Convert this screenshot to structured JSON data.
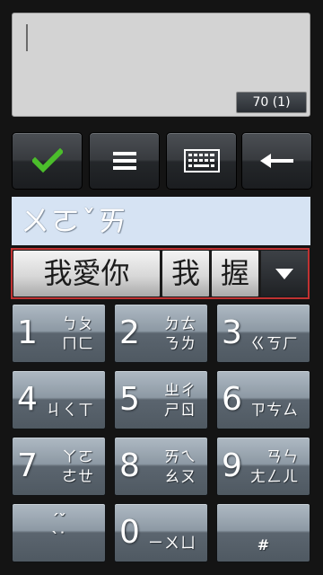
{
  "editor": {
    "char_counter": "70 (1)"
  },
  "toolbar": {
    "icons": [
      "checkmark-icon",
      "menu-icon",
      "keyboard-icon",
      "backspace-icon"
    ],
    "colors": {
      "check": "#4bbd2b"
    }
  },
  "composition": {
    "text": "ㄨㄛˇㄞ"
  },
  "candidates": {
    "items": [
      "我愛你",
      "我",
      "握"
    ],
    "more_icon": "dropdown-arrow-icon"
  },
  "keypad": {
    "keys": [
      {
        "num": "1",
        "l1": "ㄅㄆ",
        "l2": "ㄇㄈ"
      },
      {
        "num": "2",
        "l1": "ㄉㄊ",
        "l2": "ㄋㄌ"
      },
      {
        "num": "3",
        "l1": "",
        "l2": "ㄍㄎㄏ"
      },
      {
        "num": "4",
        "l1": "",
        "l2": "ㄐㄑㄒ"
      },
      {
        "num": "5",
        "l1": "ㄓㄔ",
        "l2": "ㄕㄖ"
      },
      {
        "num": "6",
        "l1": "",
        "l2": "ㄗㄘㄙ"
      },
      {
        "num": "7",
        "l1": "ㄚㄛ",
        "l2": "ㄜㄝ"
      },
      {
        "num": "8",
        "l1": "ㄞㄟ",
        "l2": "ㄠㄡ"
      },
      {
        "num": "9",
        "l1": "ㄢㄣ",
        "l2": "ㄤㄥㄦ"
      },
      {
        "num": "",
        "tone_top": "ˊˇ",
        "tone_bottom": "ˋ˙"
      },
      {
        "num": "0",
        "l1": "",
        "l2": "ㄧㄨㄩ"
      },
      {
        "num": "",
        "symbol": "#"
      }
    ]
  }
}
